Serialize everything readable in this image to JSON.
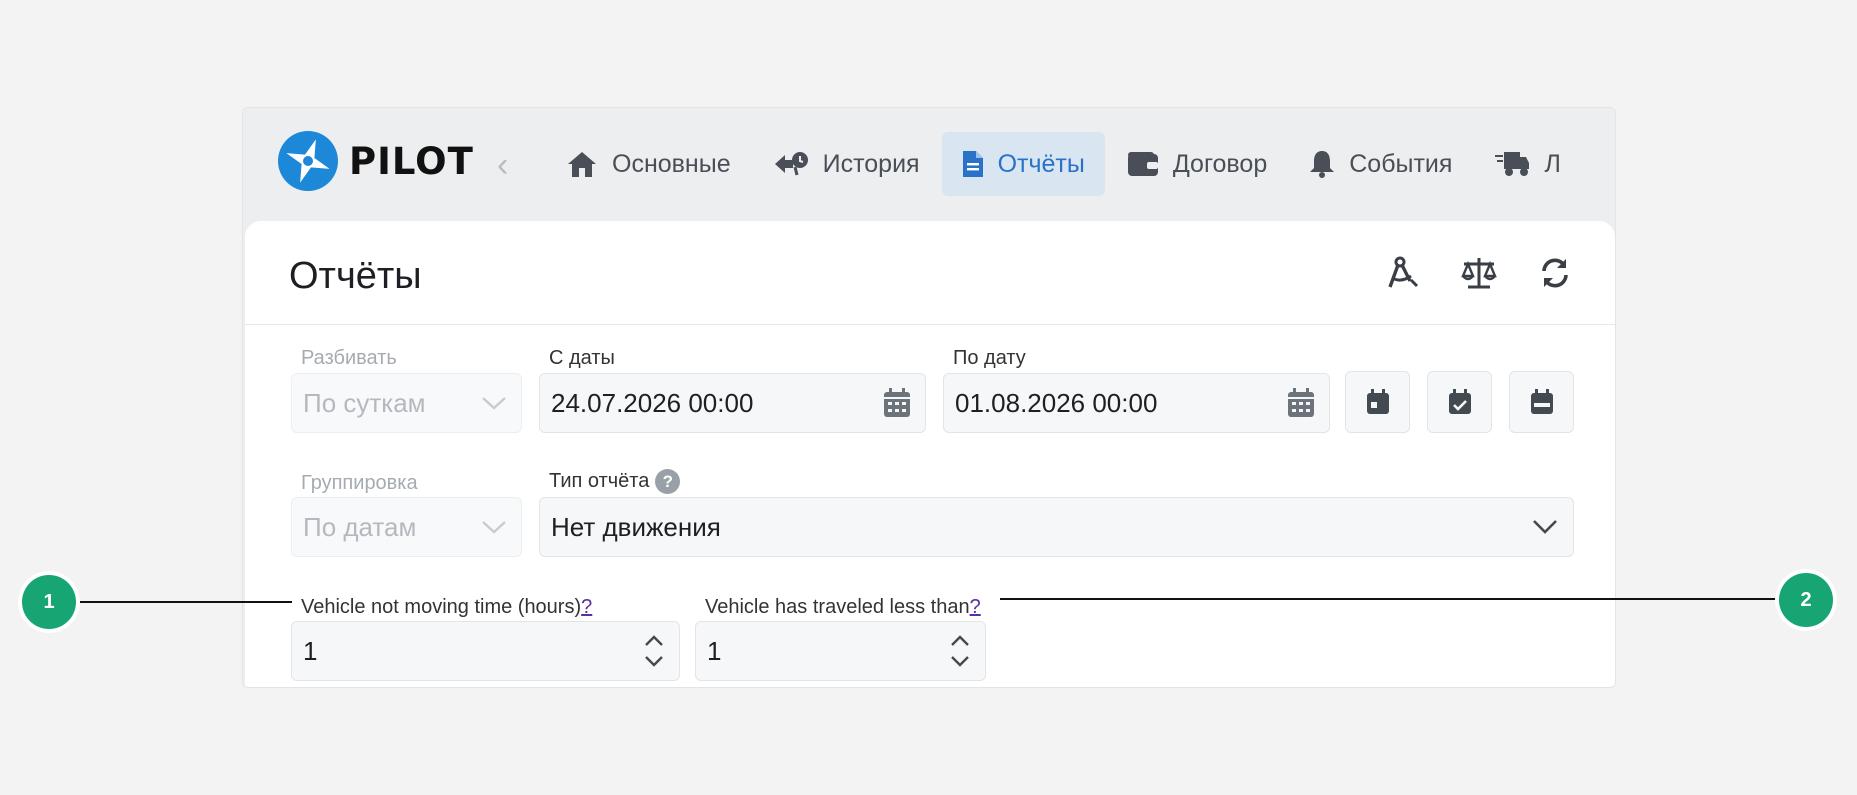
{
  "brand": {
    "name": "PILOT",
    "accent": "#2a72c8",
    "logo_color": "#1e88d8"
  },
  "nav": {
    "items": [
      {
        "label": "Основные",
        "icon": "home-icon",
        "active": false
      },
      {
        "label": "История",
        "icon": "history-icon",
        "active": false
      },
      {
        "label": "Отчёты",
        "icon": "document-icon",
        "active": true
      },
      {
        "label": "Договор",
        "icon": "wallet-icon",
        "active": false
      },
      {
        "label": "События",
        "icon": "bell-icon",
        "active": false
      },
      {
        "label": "Л",
        "icon": "truck-icon",
        "active": false
      }
    ]
  },
  "page": {
    "title": "Отчёты",
    "tools": [
      "compass-icon",
      "scales-icon",
      "refresh-icon"
    ]
  },
  "form": {
    "split": {
      "label": "Разбивать",
      "value": "По суткам"
    },
    "from_date": {
      "label": "С даты",
      "value": "24.07.2026 00:00"
    },
    "to_date": {
      "label": "По дату",
      "value": "01.08.2026 00:00"
    },
    "grouping": {
      "label": "Группировка",
      "value": "По датам"
    },
    "report_type": {
      "label": "Тип отчёта",
      "help": "?",
      "value": "Нет движения"
    },
    "not_moving": {
      "label": "Vehicle not moving time (hours)",
      "help": "?",
      "value": "1"
    },
    "traveled_less": {
      "label": "Vehicle has traveled less than",
      "help": "?",
      "value": "1"
    }
  },
  "callouts": [
    "1",
    "2"
  ],
  "colors": {
    "callout": "#17a673",
    "active_tab_bg": "#d9e5f0"
  }
}
